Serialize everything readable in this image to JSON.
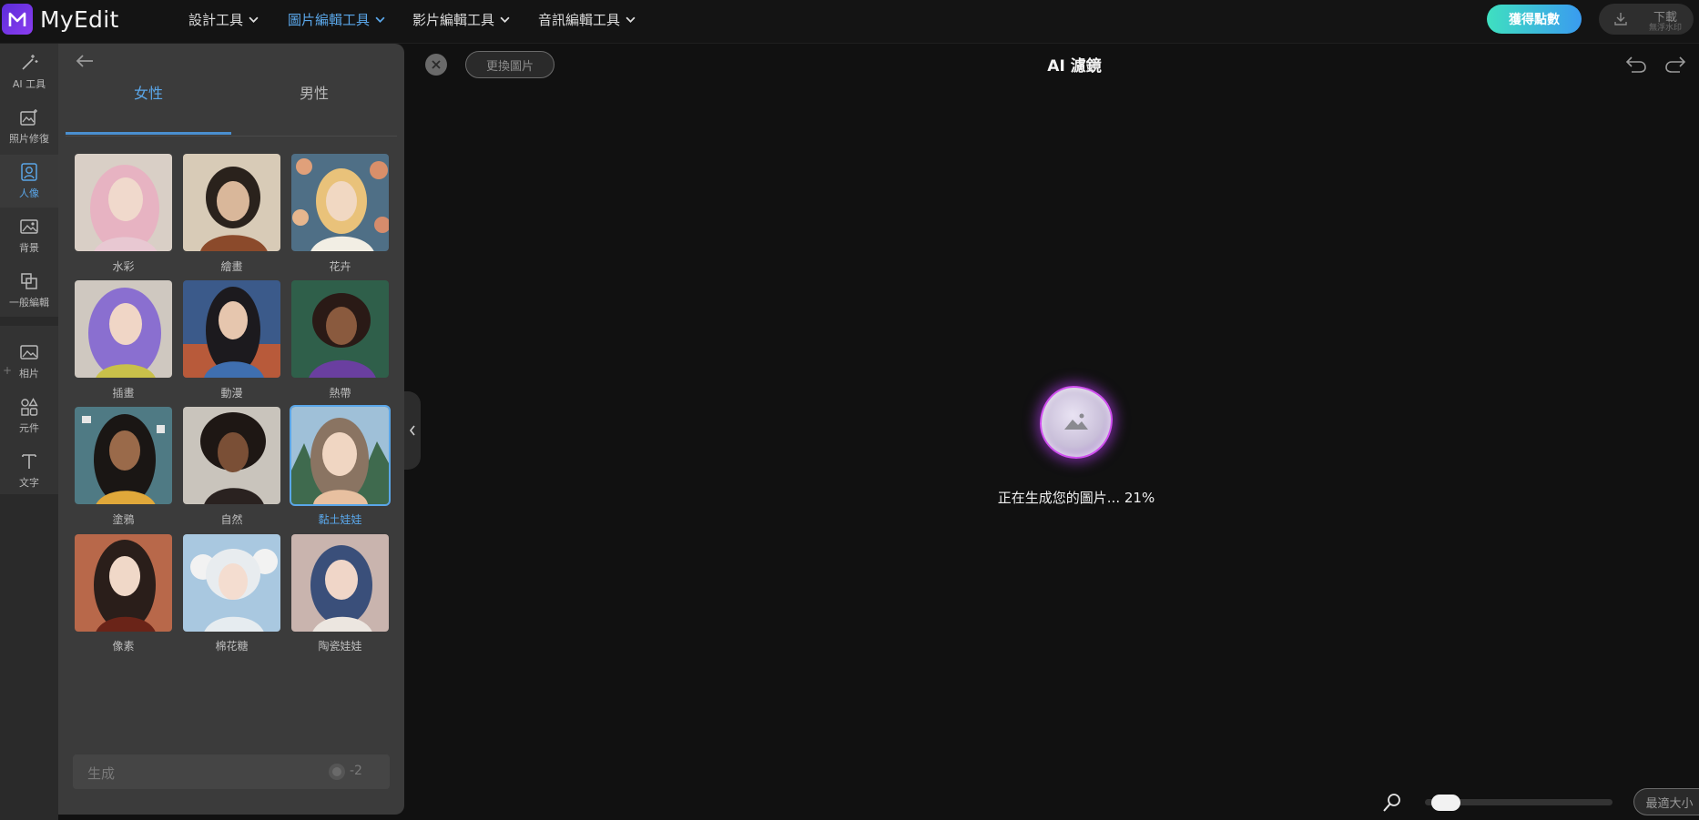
{
  "app": {
    "brand": "MyEdit",
    "logo_letter": "M",
    "accent_color": "#5aa6e8"
  },
  "topnav": [
    {
      "label": "設計工具",
      "active": false
    },
    {
      "label": "圖片編輯工具",
      "active": true
    },
    {
      "label": "影片編輯工具",
      "active": false
    },
    {
      "label": "音訊編輯工具",
      "active": false
    }
  ],
  "header_actions": {
    "get_points": "獲得點數",
    "download_line1": "下載",
    "download_line2": "無浮水印"
  },
  "rail": [
    {
      "label": "AI 工具",
      "icon": "magic-wand-icon"
    },
    {
      "label": "照片修復",
      "icon": "photo-sparkle-icon"
    },
    {
      "label": "人像",
      "icon": "portrait-icon",
      "active": true
    },
    {
      "label": "背景",
      "icon": "background-icon"
    },
    {
      "label": "一般編輯",
      "icon": "crop-icon"
    },
    {
      "label": "相片",
      "icon": "image-icon"
    },
    {
      "label": "元件",
      "icon": "shapes-icon"
    },
    {
      "label": "文字",
      "icon": "text-icon"
    }
  ],
  "rail_plus": "+",
  "panel": {
    "tabs": [
      {
        "label": "女性",
        "active": true
      },
      {
        "label": "男性",
        "active": false
      }
    ],
    "styles": [
      {
        "label": "水彩",
        "selected": false
      },
      {
        "label": "繪畫",
        "selected": false
      },
      {
        "label": "花卉",
        "selected": false
      },
      {
        "label": "插畫",
        "selected": false
      },
      {
        "label": "動漫",
        "selected": false
      },
      {
        "label": "熱帶",
        "selected": false
      },
      {
        "label": "塗鴉",
        "selected": false
      },
      {
        "label": "自然",
        "selected": false
      },
      {
        "label": "黏土娃娃",
        "selected": true
      },
      {
        "label": "像素",
        "selected": false
      },
      {
        "label": "棉花糖",
        "selected": false
      },
      {
        "label": "陶瓷娃娃",
        "selected": false
      }
    ],
    "generate_label": "生成",
    "generate_cost": "-2"
  },
  "workspace": {
    "replace_label": "更換圖片",
    "title": "AI 濾鏡",
    "progress_text": "正在生成您的圖片... 21%",
    "progress": 0.21,
    "fit_label": "最適大小",
    "zoom_level": 0.04
  }
}
